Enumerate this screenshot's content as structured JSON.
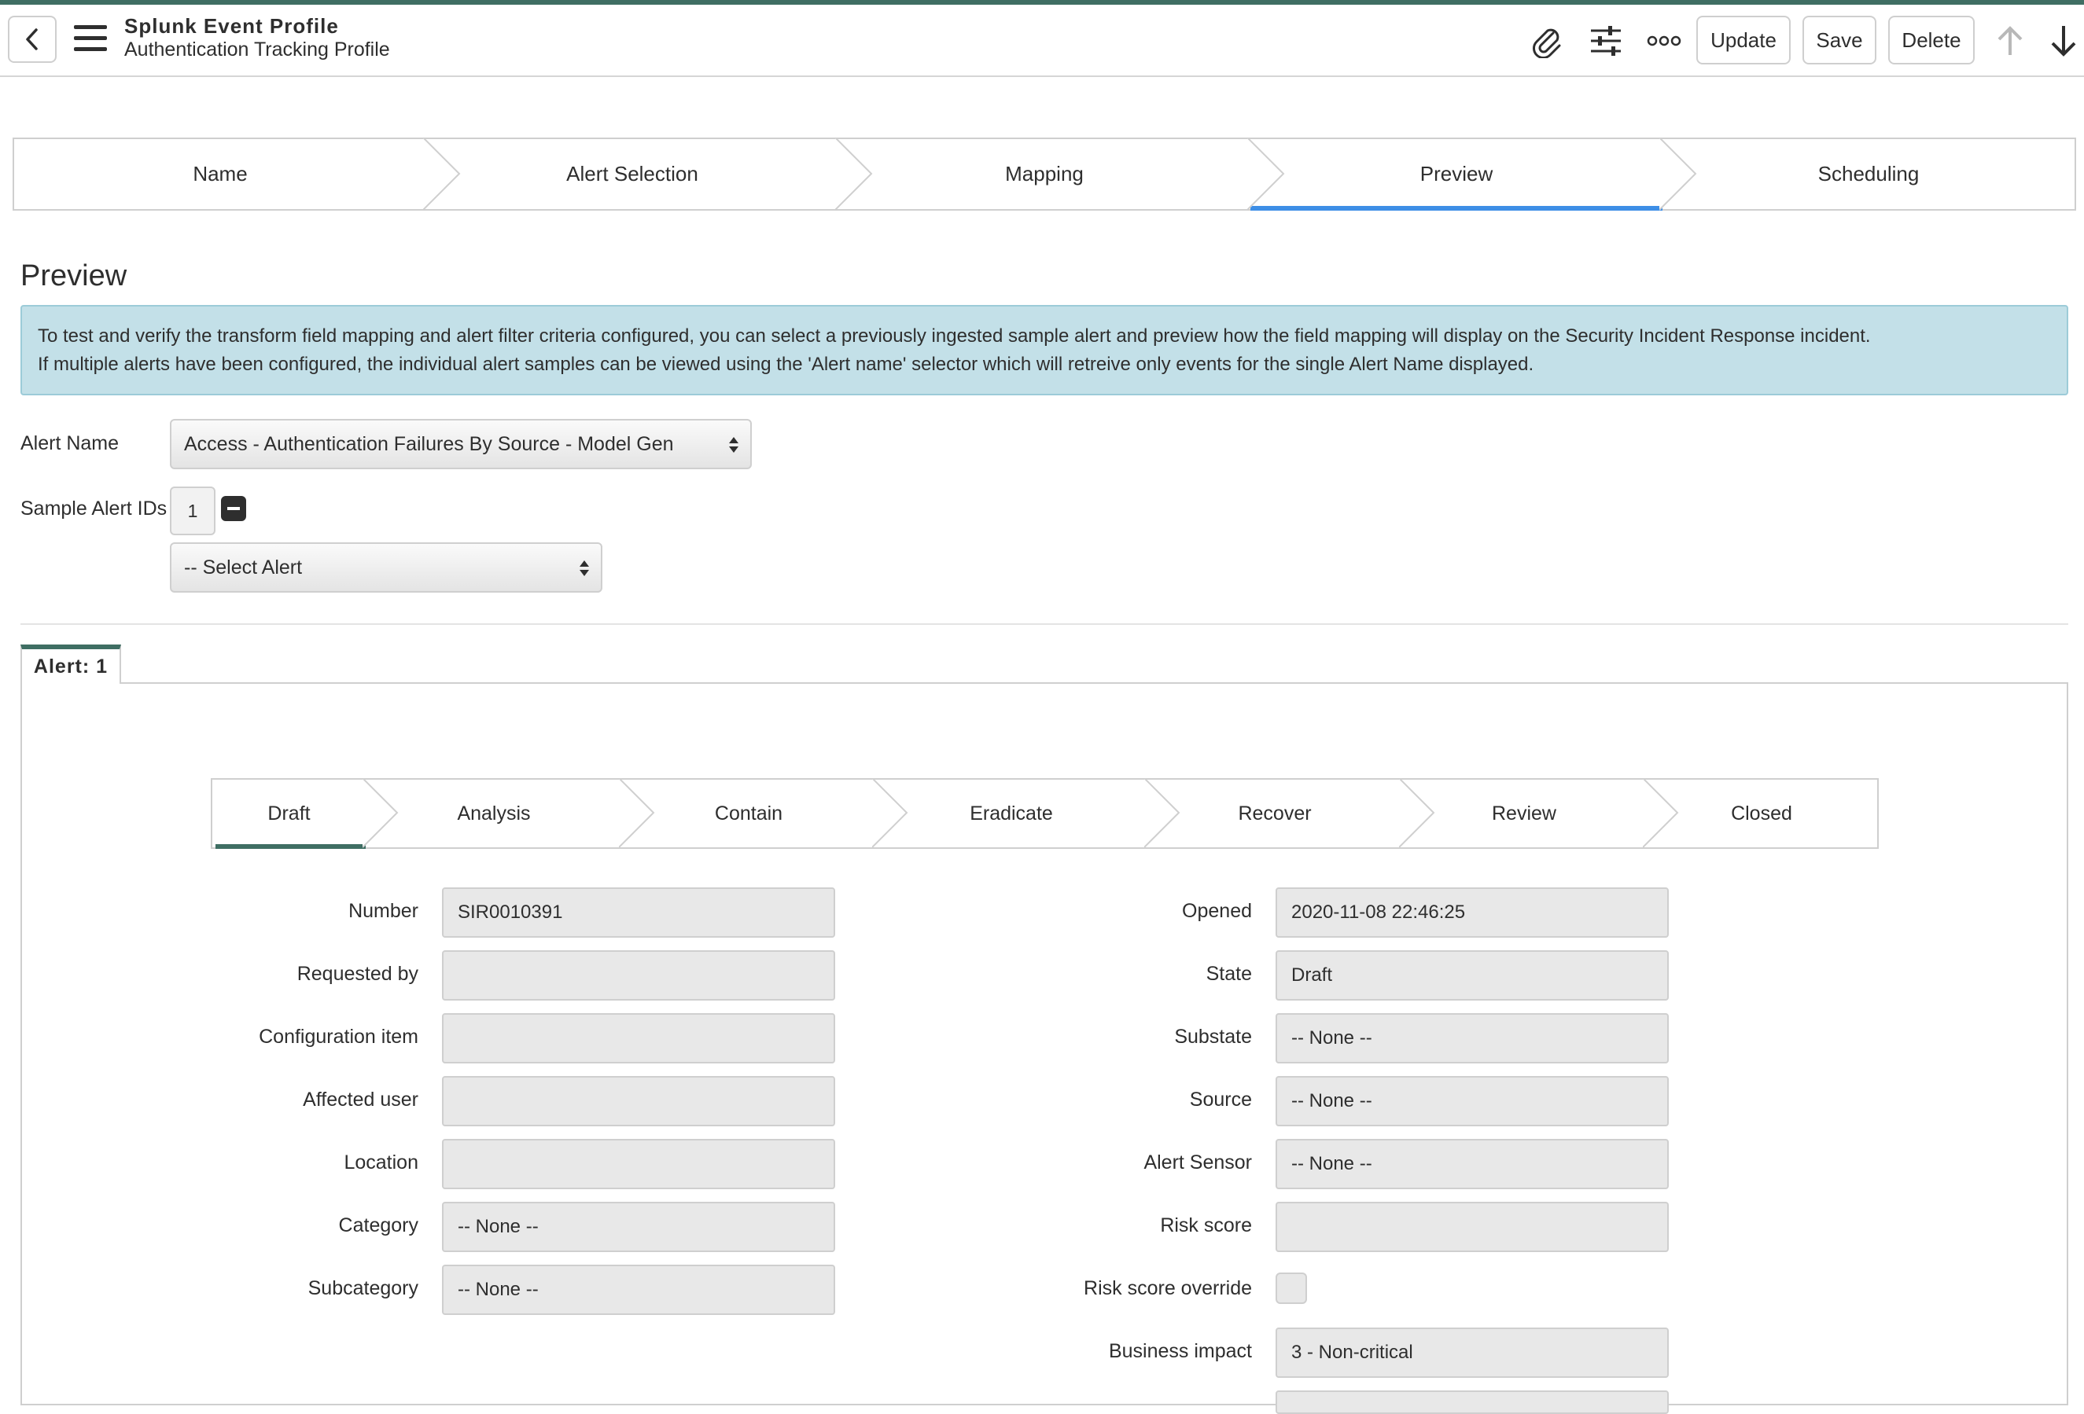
{
  "header": {
    "title": "Splunk Event Profile",
    "subtitle": "Authentication Tracking Profile",
    "buttons": {
      "update": "Update",
      "save": "Save",
      "delete": "Delete"
    },
    "icons": [
      "back-icon",
      "menu-icon",
      "paperclip-icon",
      "sliders-icon",
      "more-icon",
      "arrow-up-icon",
      "arrow-down-icon"
    ]
  },
  "wizard": {
    "steps": [
      "Name",
      "Alert Selection",
      "Mapping",
      "Preview",
      "Scheduling"
    ],
    "active": "Preview"
  },
  "preview": {
    "title": "Preview",
    "info_line1": "To test and verify the transform field mapping and alert filter criteria configured, you can select a previously ingested sample alert and preview how the field mapping will display on the Security Incident Response incident.",
    "info_line2": "If multiple alerts have been configured, the individual alert samples can be viewed using the 'Alert name' selector which will retreive only events for the single Alert Name displayed.",
    "alert_name_label": "Alert Name",
    "alert_name_value": "Access - Authentication Failures By Source - Model Gen",
    "sample_ids_label": "Sample Alert IDs",
    "sample_ids_count": "1",
    "select_alert": "-- Select Alert"
  },
  "alert_tab": {
    "label": "Alert: 1"
  },
  "states": {
    "items": [
      "Draft",
      "Analysis",
      "Contain",
      "Eradicate",
      "Recover",
      "Review",
      "Closed"
    ],
    "active": "Draft"
  },
  "form": {
    "left": [
      {
        "label": "Number",
        "value": "SIR0010391"
      },
      {
        "label": "Requested by",
        "value": ""
      },
      {
        "label": "Configuration item",
        "value": ""
      },
      {
        "label": "Affected user",
        "value": ""
      },
      {
        "label": "Location",
        "value": ""
      },
      {
        "label": "Category",
        "value": "-- None --"
      },
      {
        "label": "Subcategory",
        "value": "-- None --"
      }
    ],
    "right": [
      {
        "label": "Opened",
        "value": "2020-11-08 22:46:25"
      },
      {
        "label": "State",
        "value": "Draft"
      },
      {
        "label": "Substate",
        "value": "-- None --"
      },
      {
        "label": "Source",
        "value": "-- None --"
      },
      {
        "label": "Alert Sensor",
        "value": "-- None --"
      },
      {
        "label": "Risk score",
        "value": ""
      },
      {
        "label": "Risk score override",
        "value": ""
      },
      {
        "label": "Business impact",
        "value": "3 - Non-critical"
      }
    ]
  },
  "colors": {
    "accent_green": "#3f6e63",
    "active_step_blue": "#3d8ee6",
    "info_bg": "#c3e0e8",
    "field_bg": "#e8e8e8"
  }
}
